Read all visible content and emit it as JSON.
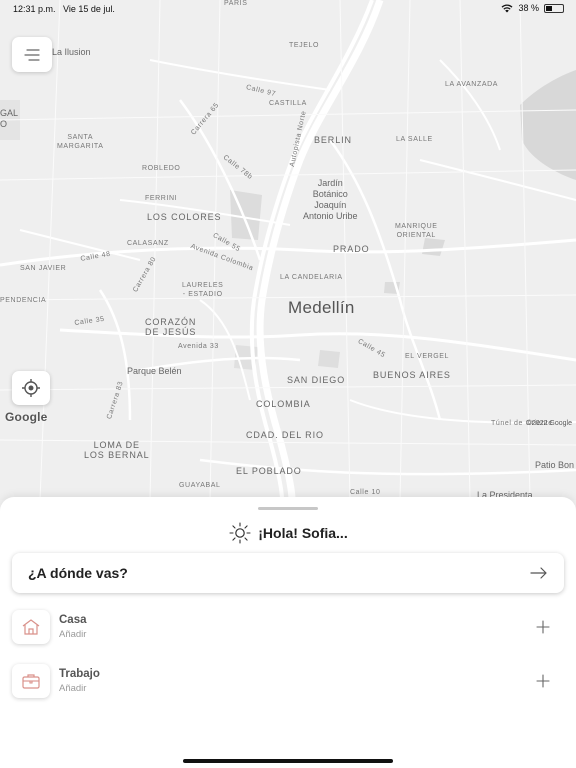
{
  "status_bar": {
    "time": "12:31 p.m.",
    "date": "Vie 15 de jul.",
    "battery": "38 %",
    "battery_level": 0.38
  },
  "map": {
    "labels": {
      "paris": "PARIS",
      "tejelo": "TEJELO",
      "la_ilusion": "La Ilusion",
      "la_avanzada": "LA AVANZADA",
      "gal": "GAL",
      "o": "O",
      "calle_97": "Calle 97",
      "castilla": "CASTILLA",
      "carrera_65": "Carrera 65",
      "santa_margarita": "SANTA\nMARGARITA",
      "autopista_norte": "Autopista Norte",
      "berlin": "BERLIN",
      "la_salle": "LA SALLE",
      "calle_78b": "Calle 78b",
      "robledo": "ROBLEDO",
      "jardin_botanico": "Jardín\nBotánico\nJoaquín\nAntonio Uribe",
      "ferrini": "FERRINI",
      "los_colores": "LOS COLORES",
      "manrique_oriental": "MANRIQUE\nORIENTAL",
      "calasanz": "CALASANZ",
      "calle_55": "Calle 55",
      "avenida_colombia": "Avenida Colombia",
      "prado": "PRADO",
      "calle_48": "Calle 48",
      "carrera_80": "Carrera 80",
      "san_javier": "SAN JAVIER",
      "la_candelaria": "LA CANDELARIA",
      "laureles": "LAURELES\n- ESTADIO",
      "pendencia": "PENDENCIA",
      "medellin": "Medellín",
      "calle_35": "Calle 35",
      "corazon_de_jesus": "CORAZÓN\nDE JESÚS",
      "calle_45": "Calle 45",
      "el_vergel": "EL VERGEL",
      "avenida_33": "Avenida 33",
      "parque_belen": "Parque Belén",
      "san_diego": "SAN DIEGO",
      "buenos_aires": "BUENOS AIRES",
      "carrera_83": "Carrera 83",
      "colombia": "COLOMBIA",
      "tunel_oriente": "Túnel de Oriente",
      "loma_de_los_bernal": "LOMA DE\nLOS BERNAL",
      "cdad_del_rio": "CDAD. DEL RIO",
      "el_poblado": "EL POBLADO",
      "patio_bonito": "Patio Bon",
      "guayabal": "GUAYABAL",
      "calle_10": "Calle 10",
      "la_presidenta": "La Presidenta"
    },
    "google_logo": "Google",
    "copyright": "©2022 Google"
  },
  "sheet": {
    "greeting": "¡Hola! Sofia...",
    "search_placeholder": "¿A dónde vas?",
    "places": [
      {
        "title": "Casa",
        "subtitle": "Añadir",
        "icon": "home-icon"
      },
      {
        "title": "Trabajo",
        "subtitle": "Añadir",
        "icon": "briefcase-icon"
      }
    ]
  },
  "colors": {
    "map_bg": "#efefef",
    "accent": "#d9918a",
    "text": "#222222"
  }
}
